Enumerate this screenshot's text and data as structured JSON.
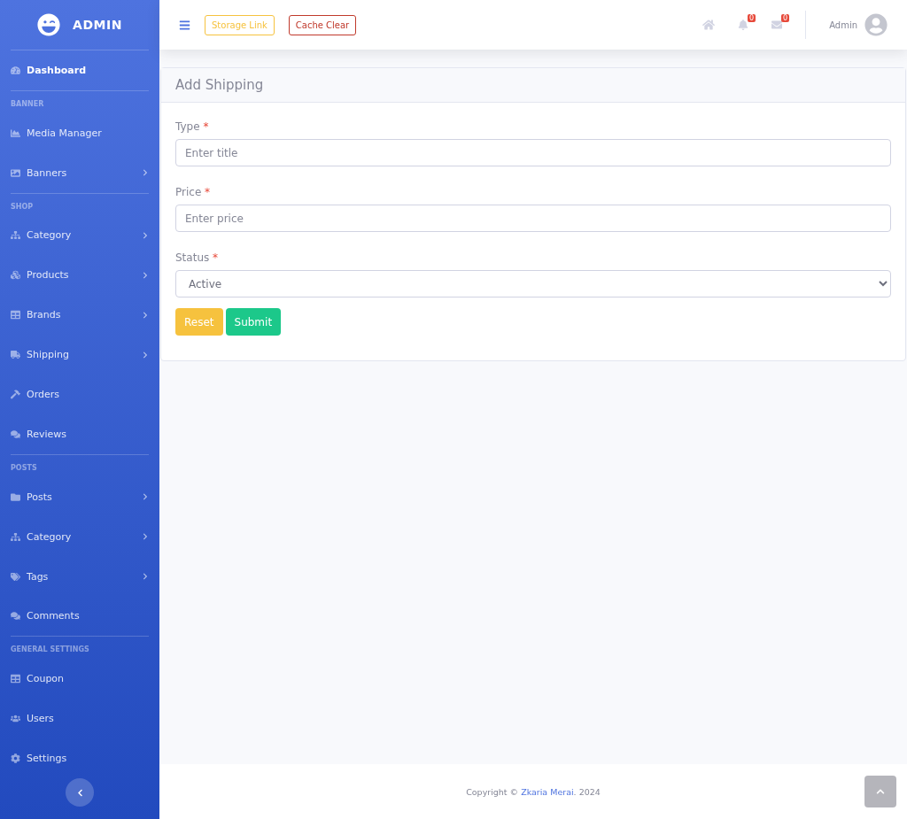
{
  "sidebar": {
    "brand": "ADMIN",
    "items": [
      {
        "kind": "divider"
      },
      {
        "kind": "link",
        "label": "Dashboard",
        "selected": true,
        "has_children": false
      },
      {
        "kind": "divider"
      },
      {
        "kind": "heading",
        "label": "BANNER"
      },
      {
        "kind": "link",
        "label": "Media Manager",
        "selected": false,
        "has_children": false
      },
      {
        "kind": "link",
        "label": "Banners",
        "selected": false,
        "has_children": true
      },
      {
        "kind": "divider"
      },
      {
        "kind": "heading",
        "label": "SHOP"
      },
      {
        "kind": "link",
        "label": "Category",
        "selected": false,
        "has_children": true
      },
      {
        "kind": "link",
        "label": "Products",
        "selected": false,
        "has_children": true
      },
      {
        "kind": "link",
        "label": "Brands",
        "selected": false,
        "has_children": true
      },
      {
        "kind": "link",
        "label": "Shipping",
        "selected": false,
        "has_children": true
      },
      {
        "kind": "link",
        "label": "Orders",
        "selected": false,
        "has_children": false
      },
      {
        "kind": "link",
        "label": "Reviews",
        "selected": false,
        "has_children": false
      },
      {
        "kind": "divider"
      },
      {
        "kind": "heading",
        "label": "POSTS"
      },
      {
        "kind": "link",
        "label": "Posts",
        "selected": false,
        "has_children": true
      },
      {
        "kind": "link",
        "label": "Category",
        "selected": false,
        "has_children": true
      },
      {
        "kind": "link",
        "label": "Tags",
        "selected": false,
        "has_children": true
      },
      {
        "kind": "link",
        "label": "Comments",
        "selected": false,
        "has_children": false
      },
      {
        "kind": "divider"
      },
      {
        "kind": "heading",
        "label": "GENERAL SETTINGS"
      },
      {
        "kind": "link",
        "label": "Coupon",
        "selected": false,
        "has_children": false
      },
      {
        "kind": "link",
        "label": "Users",
        "selected": false,
        "has_children": false
      },
      {
        "kind": "link",
        "label": "Settings",
        "selected": false,
        "has_children": false
      }
    ]
  },
  "topbar": {
    "buttons": [
      {
        "label": "Storage Link",
        "color": "#f6c23e"
      },
      {
        "label": "Cache Clear",
        "color": "#c0392b"
      }
    ],
    "alerts_count": "0",
    "messages_count": "0",
    "user_name": "Admin"
  },
  "card": {
    "title": "Add Shipping",
    "fields": [
      {
        "kind": "text",
        "label": "Type",
        "required_mark": "*",
        "placeholder": "Enter title"
      },
      {
        "kind": "text",
        "label": "Price",
        "required_mark": "*",
        "placeholder": "Enter price"
      },
      {
        "kind": "select",
        "label": "Status",
        "required_mark": "*",
        "value": "Active"
      }
    ],
    "buttons": [
      {
        "label": "Reset",
        "color": "#f6c23e"
      },
      {
        "label": "Submit",
        "color": "#1cc88a"
      }
    ]
  },
  "footer": {
    "prefix": "Copyright ©",
    "link": "Zkaria Merai",
    "suffix": ". 2024"
  }
}
